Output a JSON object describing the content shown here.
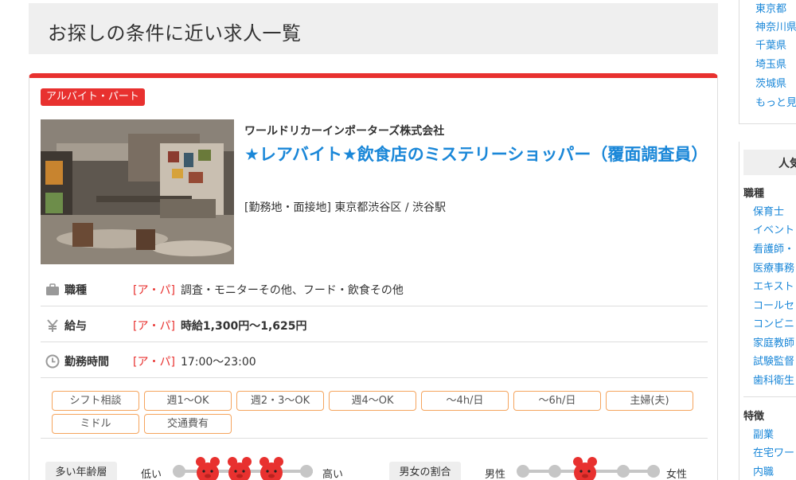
{
  "page_title": "お探しの条件に近い求人一覧",
  "job": {
    "employment_type": "アルバイト・パート",
    "company": "ワールドリカーインポーターズ株式会社",
    "title": "★レアバイト★飲食店のミステリーショッパー（覆面調査員）",
    "location": "[勤務地・面接地] 東京都渋谷区 / 渋谷駅",
    "rows": [
      {
        "label": "職種",
        "tag": "[ア・パ]",
        "value": "調査・モニターその他、フード・飲食その他"
      },
      {
        "label": "給与",
        "tag": "[ア・パ]",
        "value": "時給1,300円〜1,625円"
      },
      {
        "label": "勤務時間",
        "tag": "[ア・パ]",
        "value": "17:00〜23:00"
      }
    ],
    "features": [
      "シフト相談",
      "週1〜OK",
      "週2・3〜OK",
      "週4〜OK",
      "〜4h/日",
      "〜6h/日",
      "主婦(夫)",
      "ミドル",
      "交通費有"
    ],
    "age_meter": {
      "label": "多い年齢層",
      "low": "低い",
      "high": "高い",
      "level": 0.5
    },
    "gender_meter": {
      "label": "男女の割合",
      "male": "男性",
      "female": "女性",
      "level": 0.5
    }
  },
  "sidebar": {
    "prefectures": [
      "東京都",
      "神奈川県",
      "千葉県",
      "埼玉県",
      "茨城県",
      "もっと見"
    ],
    "popular_heading": "人気",
    "categories": [
      {
        "heading": "職種",
        "links": [
          "保育士",
          "イベント",
          "看護師・",
          "医療事務",
          "エキスト",
          "コールセ",
          "コンビニ",
          "家庭教師",
          "試験監督",
          "歯科衛生"
        ]
      },
      {
        "heading": "特徴",
        "links": [
          "副業",
          "在宅ワー",
          "内職"
        ]
      }
    ]
  },
  "colors": {
    "accent": "#e8312f",
    "link": "#1a87d8",
    "chip_border": "#f5a45d",
    "mascot": "#e8312f"
  }
}
